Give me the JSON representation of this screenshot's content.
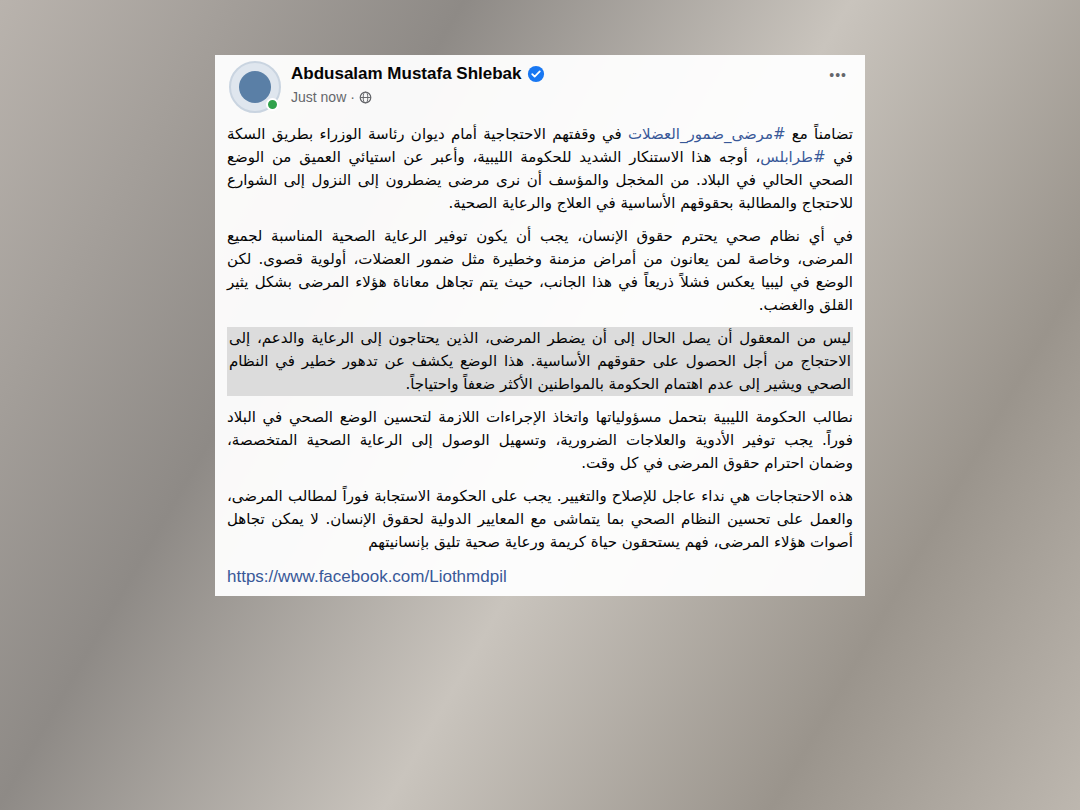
{
  "post": {
    "author": "Abdusalam Mustafa Shlebak",
    "verified": true,
    "online": true,
    "time": "Just now",
    "separator": "·",
    "more": "•••",
    "paragraphs": [
      {
        "highlighted": false,
        "segments": [
          {
            "text": "تضامناً مع ",
            "hashtag": false
          },
          {
            "text": "#مرضى_ضمور_العضلات",
            "hashtag": true
          },
          {
            "text": " في وقفتهم الاحتجاجية أمام ديوان رئاسة الوزراء بطريق السكة في ",
            "hashtag": false
          },
          {
            "text": "#طرابلس",
            "hashtag": true
          },
          {
            "text": "، أوجه هذا الاستنكار الشديد للحكومة الليبية، وأعبر عن استيائي العميق من الوضع الصحي الحالي في البلاد. من المخجل والمؤسف أن نرى مرضى يضطرون إلى النزول إلى الشوارع للاحتجاج والمطالبة بحقوقهم الأساسية في العلاج والرعاية الصحية.",
            "hashtag": false
          }
        ]
      },
      {
        "highlighted": false,
        "segments": [
          {
            "text": "في أي نظام صحي يحترم حقوق الإنسان، يجب أن يكون توفير الرعاية الصحية المناسبة لجميع المرضى، وخاصة لمن يعانون من أمراض مزمنة وخطيرة مثل ضمور العضلات، أولوية قصوى. لكن الوضع في ليبيا يعكس فشلاً ذريعاً في هذا الجانب، حيث يتم تجاهل معاناة هؤلاء المرضى بشكل يثير القلق والغضب.",
            "hashtag": false
          }
        ]
      },
      {
        "highlighted": true,
        "segments": [
          {
            "text": "ليس من المعقول أن يصل الحال إلى أن يضطر المرضى، الذين يحتاجون إلى الرعاية والدعم، إلى الاحتجاج من أجل الحصول على حقوقهم الأساسية. هذا الوضع يكشف عن تدهور خطير في النظام الصحي ويشير إلى عدم اهتمام الحكومة بالمواطنين الأكثر ضعفاً واحتياجاً.",
            "hashtag": false
          }
        ]
      },
      {
        "highlighted": false,
        "segments": [
          {
            "text": "نطالب الحكومة الليبية بتحمل مسؤولياتها واتخاذ الإجراءات اللازمة لتحسين الوضع الصحي في البلاد فوراً. يجب توفير الأدوية والعلاجات الضرورية، وتسهيل الوصول إلى الرعاية الصحية المتخصصة، وضمان احترام حقوق المرضى في كل وقت.",
            "hashtag": false
          }
        ]
      },
      {
        "highlighted": false,
        "segments": [
          {
            "text": "هذه الاحتجاجات هي نداء عاجل للإصلاح والتغيير. يجب على الحكومة الاستجابة فوراً لمطالب المرضى، والعمل على تحسين النظام الصحي بما يتماشى مع المعايير الدولية لحقوق الإنسان. لا يمكن تجاهل أصوات هؤلاء المرضى، فهم يستحقون حياة كريمة ورعاية صحية تليق بإنسانيتهم",
            "hashtag": false
          }
        ]
      }
    ],
    "link": "https://www.facebook.com/Liothmdpil"
  }
}
